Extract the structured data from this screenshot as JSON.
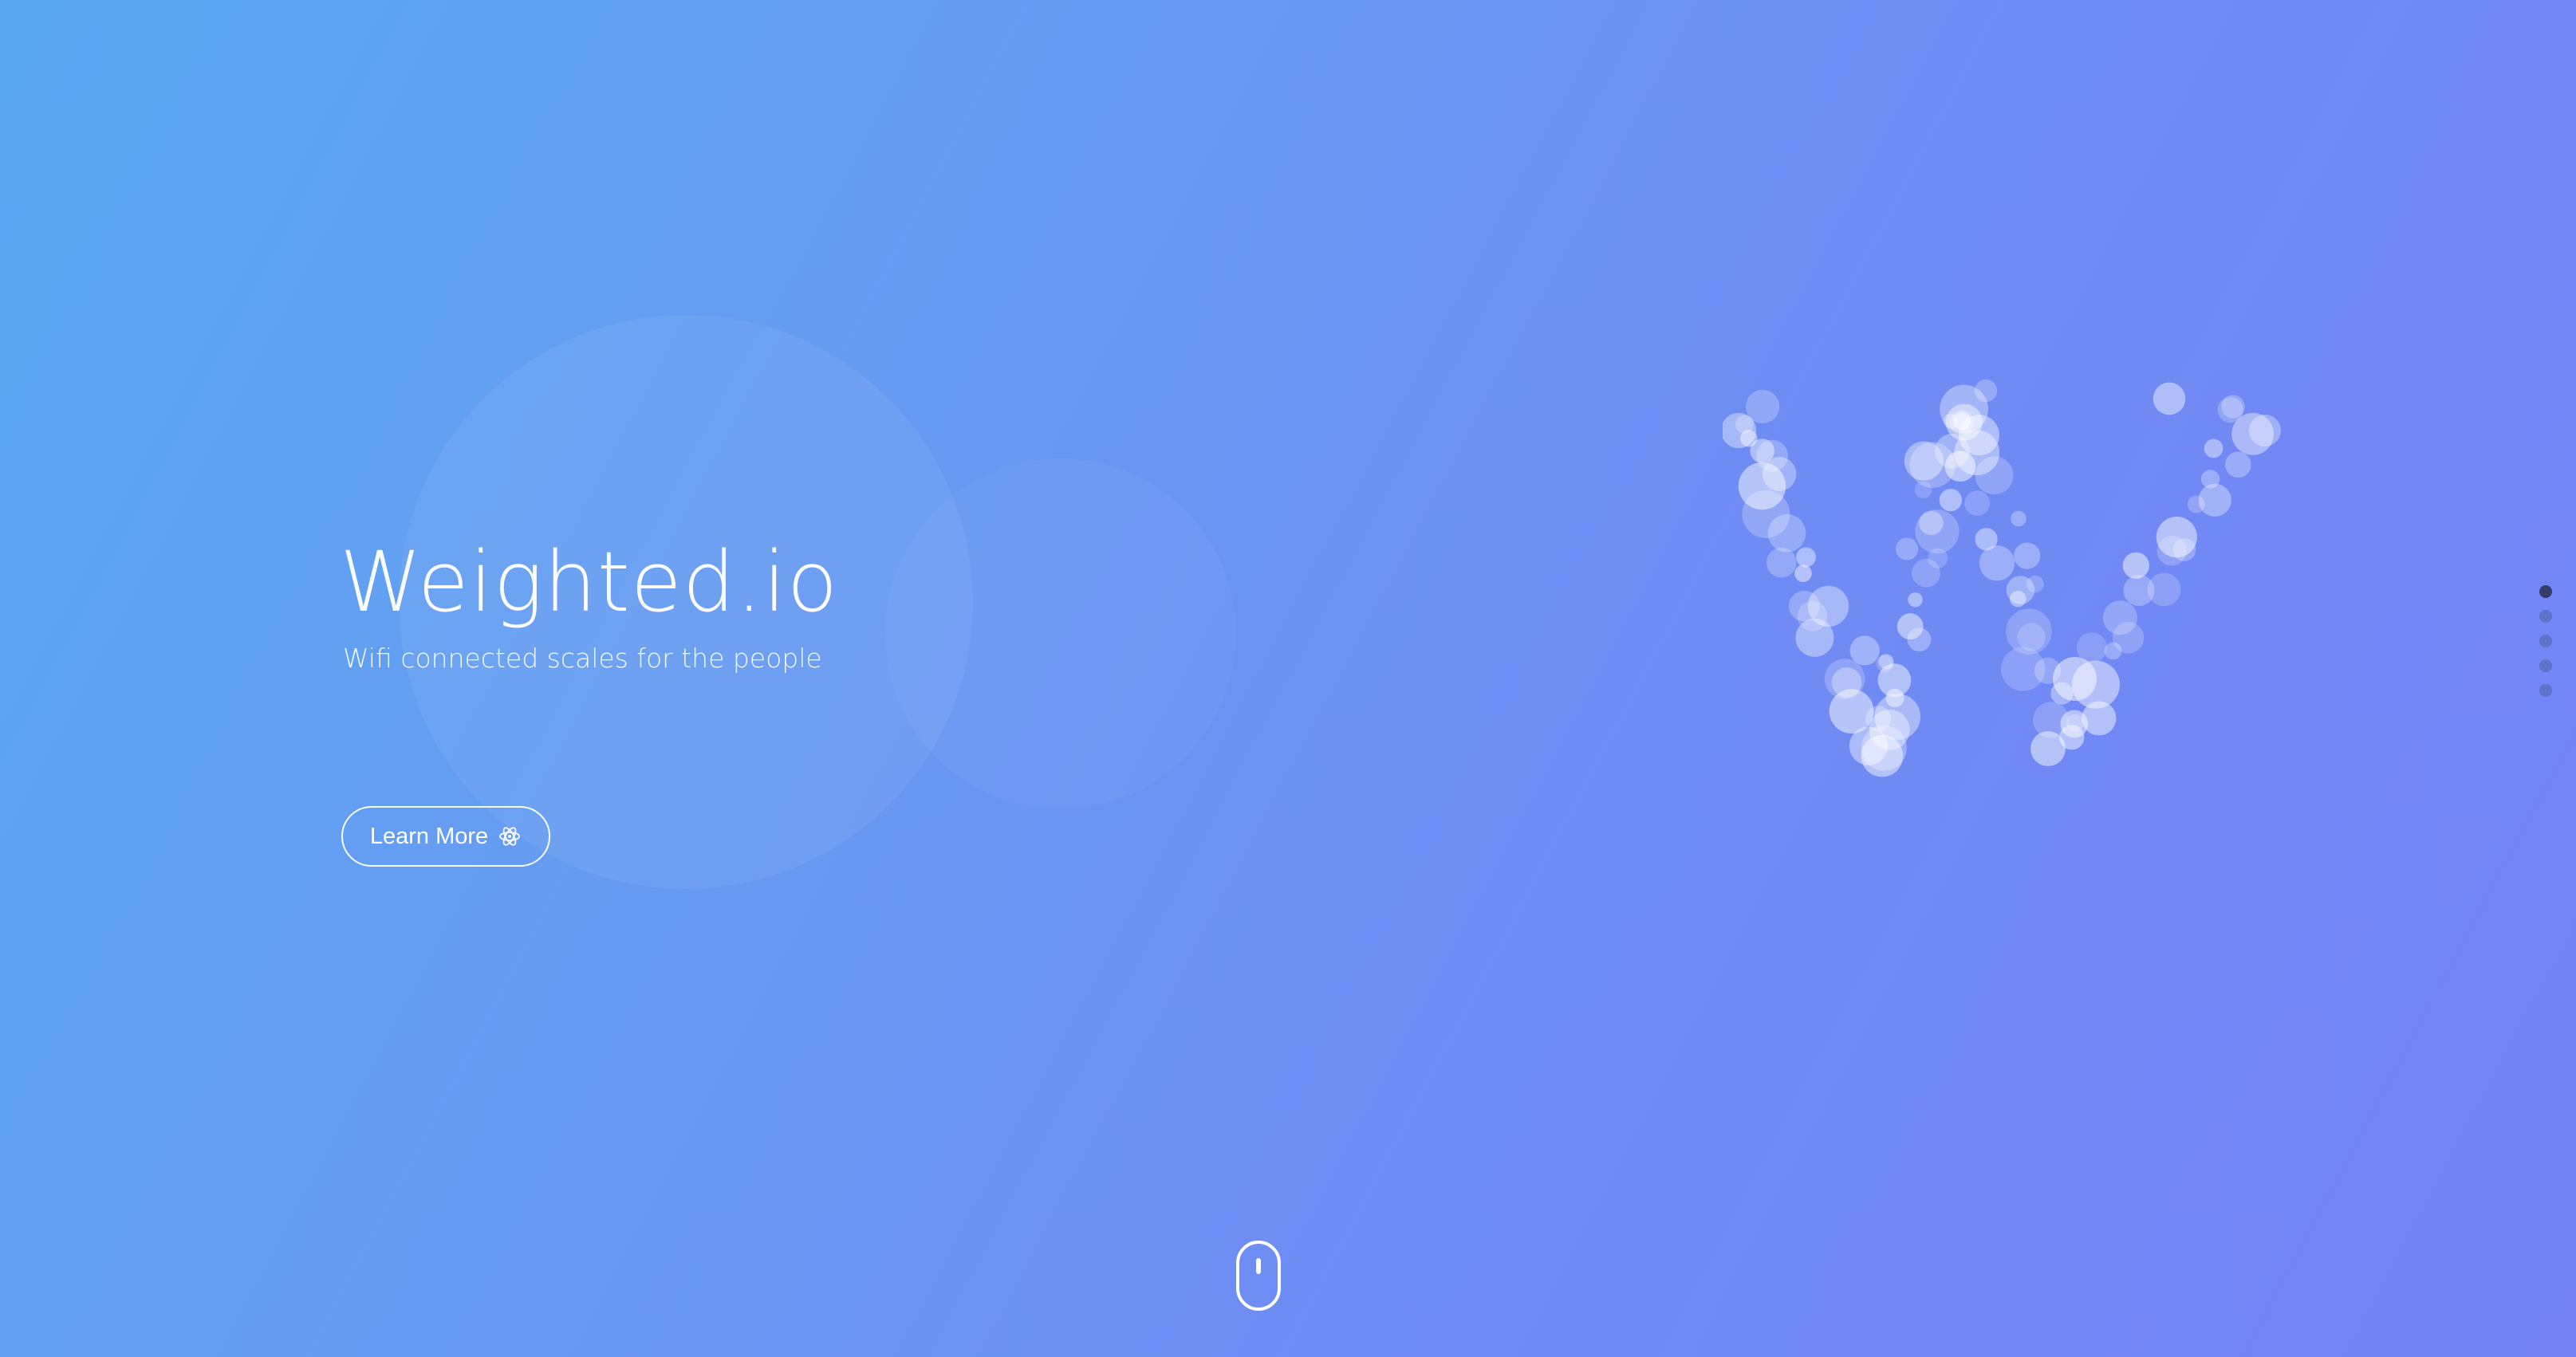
{
  "hero": {
    "title": "Weighted.io",
    "subtitle": "Wifi connected scales for the people",
    "cta_label": "Learn More"
  },
  "icons": {
    "cta_icon": "atom-icon",
    "scroll_indicator": "mouse-scroll-icon",
    "logo": "bubble-w-logo"
  },
  "pagination": {
    "total": 5,
    "active_index": 0
  },
  "colors": {
    "gradient_start": "#5aa8f2",
    "gradient_end": "#7583f5",
    "foreground": "#ffffff"
  }
}
